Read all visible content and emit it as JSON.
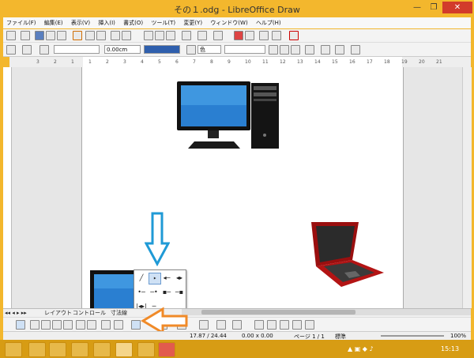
{
  "window": {
    "title": "その１.odg - LibreOffice Draw",
    "minimize": "—",
    "restore": "❐",
    "close": "✕"
  },
  "menu": [
    "ファイル(F)",
    "編集(E)",
    "表示(V)",
    "挿入(I)",
    "書式(O)",
    "ツール(T)",
    "変更(Y)",
    "ウィンドウ(W)",
    "ヘルプ(H)"
  ],
  "line_toolbar": {
    "line_width": "0.00cm",
    "area_style": "色"
  },
  "ruler_numbers": [
    "3",
    "2",
    "1",
    "1",
    "2",
    "3",
    "4",
    "5",
    "6",
    "7",
    "8",
    "9",
    "10",
    "11",
    "12",
    "13",
    "14",
    "15",
    "16",
    "17",
    "18",
    "19",
    "20",
    "21"
  ],
  "tabs": [
    "レイアウト",
    "コントロール",
    "寸法線"
  ],
  "status": {
    "position": "17.87 / 24.44",
    "size": "0.00 x 0.00",
    "page": "ページ 1 / 1",
    "style": "標準",
    "zoom": "100%"
  },
  "taskbar": {
    "clock": "15:13"
  },
  "colors": {
    "frame": "#f3b72d",
    "annotation_arrow_blue": "#1f9ad6",
    "annotation_arrow_orange": "#f08a28"
  },
  "icons": {
    "desktop": "desktop-computer-icon",
    "laptop": "laptop-icon",
    "monitor": "monitor-icon"
  }
}
